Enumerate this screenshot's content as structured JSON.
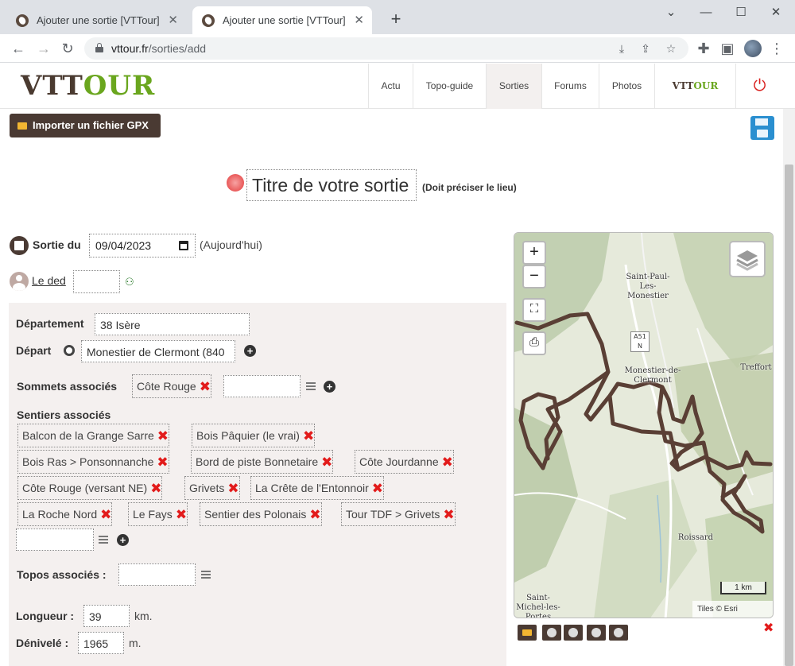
{
  "browser": {
    "tabs": [
      {
        "title": "Ajouter une sortie [VTTour]",
        "active": false
      },
      {
        "title": "Ajouter une sortie [VTTour]",
        "active": true
      }
    ],
    "url_host": "vttour.fr",
    "url_path": "/sorties/add"
  },
  "site": {
    "logo_part1": "VTT",
    "logo_part2": "OUR",
    "nav": [
      "Actu",
      "Topo-guide",
      "Sorties",
      "Forums",
      "Photos"
    ],
    "nav_logo_part1": "VTT",
    "nav_logo_part2": "OUR",
    "brand_color": "#4a3a33",
    "accent_color": "#6aa61e"
  },
  "form": {
    "import_gpx": "Importer un fichier GPX",
    "title_placeholder": "Titre de votre sortie",
    "title_hint": "(Doit préciser le lieu)",
    "date_label": "Sortie du",
    "date_value": "09/04/2023",
    "date_hint": "(Aujourd'hui)",
    "user_link": "Le ded",
    "departement_label": "Département",
    "departement_value": "38 Isère",
    "depart_label": "Départ",
    "depart_value": "Monestier de Clermont (840",
    "sommets_label": "Sommets associés",
    "sommets": [
      "Côte Rouge"
    ],
    "sentiers_label": "Sentiers associés",
    "sentiers": [
      "Balcon de la Grange Sarre",
      "Bois Pâquier (le vrai)",
      "Bois Ras > Ponsonnanche",
      "Bord de piste Bonnetaire",
      "Côte Jourdanne",
      "Côte Rouge (versant NE)",
      "Grivets",
      "La Crête de l'Entonnoir",
      "La Roche Nord",
      "Le Fays",
      "Sentier des Polonais",
      "Tour TDF > Grivets"
    ],
    "topos_label": "Topos associés :",
    "longueur_label": "Longueur :",
    "longueur_value": "39",
    "longueur_unit": "km.",
    "denivele_label": "Dénivelé :",
    "denivele_value": "1965",
    "denivele_unit": "m."
  },
  "map": {
    "zoom_in": "+",
    "zoom_out": "−",
    "places": [
      "Saint-Paul-Les-Monestier",
      "Monestier-de-Clermont",
      "Treffort",
      "Roissard",
      "Saint-Michel-les-Portes"
    ],
    "road": "A51 N",
    "scale": "1 km",
    "attribution": "Tiles © Esri",
    "track_color": "#5a3f35"
  }
}
